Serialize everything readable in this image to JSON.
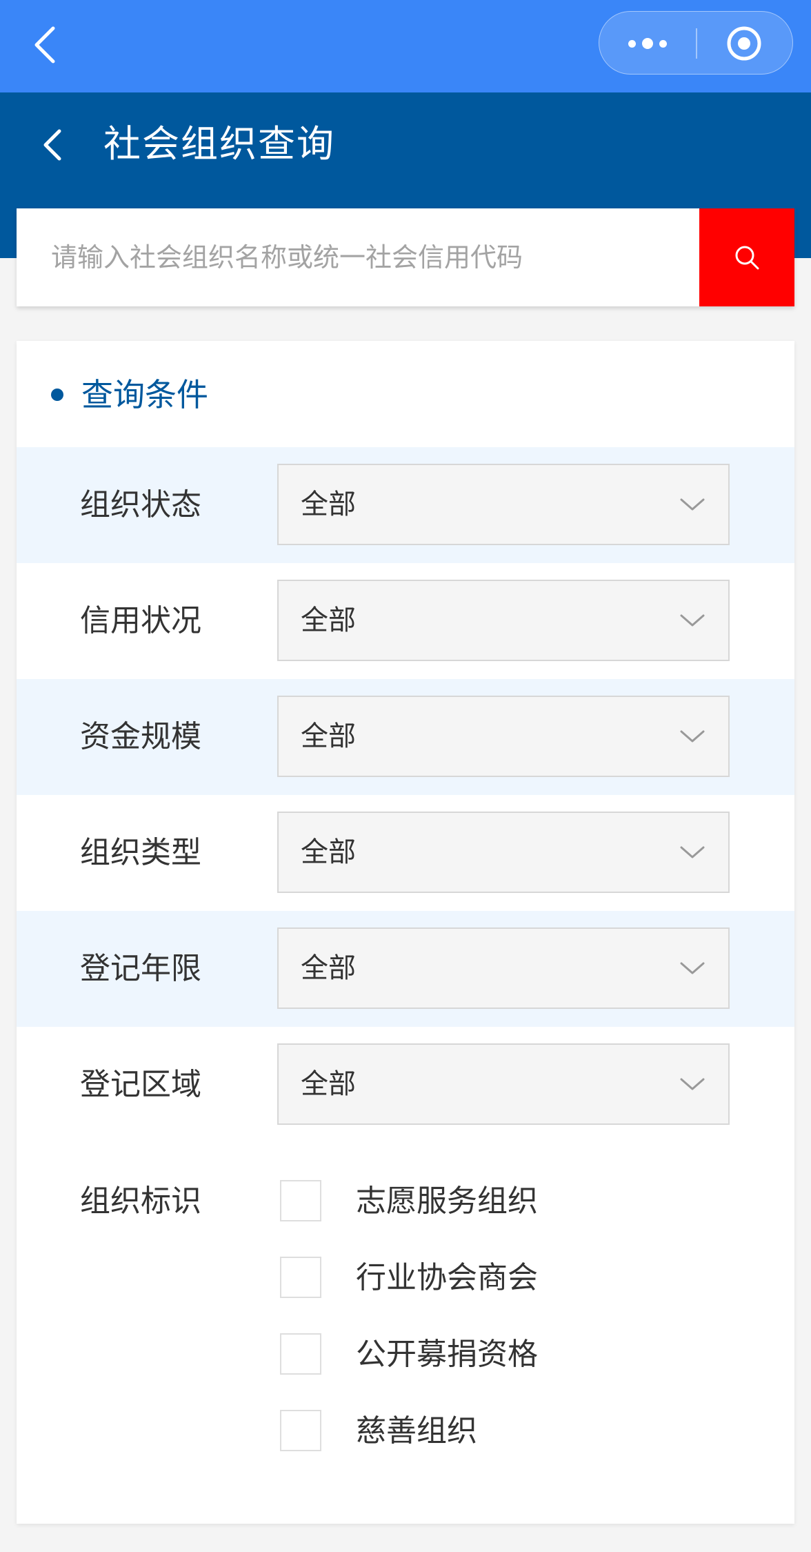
{
  "page": {
    "title": "社会组织查询"
  },
  "search": {
    "placeholder": "请输入社会组织名称或统一社会信用代码"
  },
  "conditions": {
    "section_title": "查询条件",
    "filters": [
      {
        "label": "组织状态",
        "value": "全部"
      },
      {
        "label": "信用状况",
        "value": "全部"
      },
      {
        "label": "资金规模",
        "value": "全部"
      },
      {
        "label": "组织类型",
        "value": "全部"
      },
      {
        "label": "登记年限",
        "value": "全部"
      },
      {
        "label": "登记区域",
        "value": "全部"
      }
    ],
    "flags_label": "组织标识",
    "flags": [
      {
        "label": "志愿服务组织",
        "checked": false
      },
      {
        "label": "行业协会商会",
        "checked": false
      },
      {
        "label": "公开募捐资格",
        "checked": false
      },
      {
        "label": "慈善组织",
        "checked": false
      }
    ]
  },
  "colors": {
    "topbar": "#3a86f8",
    "header": "#00589d",
    "search_button": "#ff0000",
    "row_alt": "#eef6fe"
  },
  "icons": {
    "top_back": "chevron-left-icon",
    "menu": "more-dots-icon",
    "close": "target-circle-icon",
    "header_back": "chevron-left-icon",
    "search": "search-icon",
    "dropdown": "chevron-down-icon"
  }
}
